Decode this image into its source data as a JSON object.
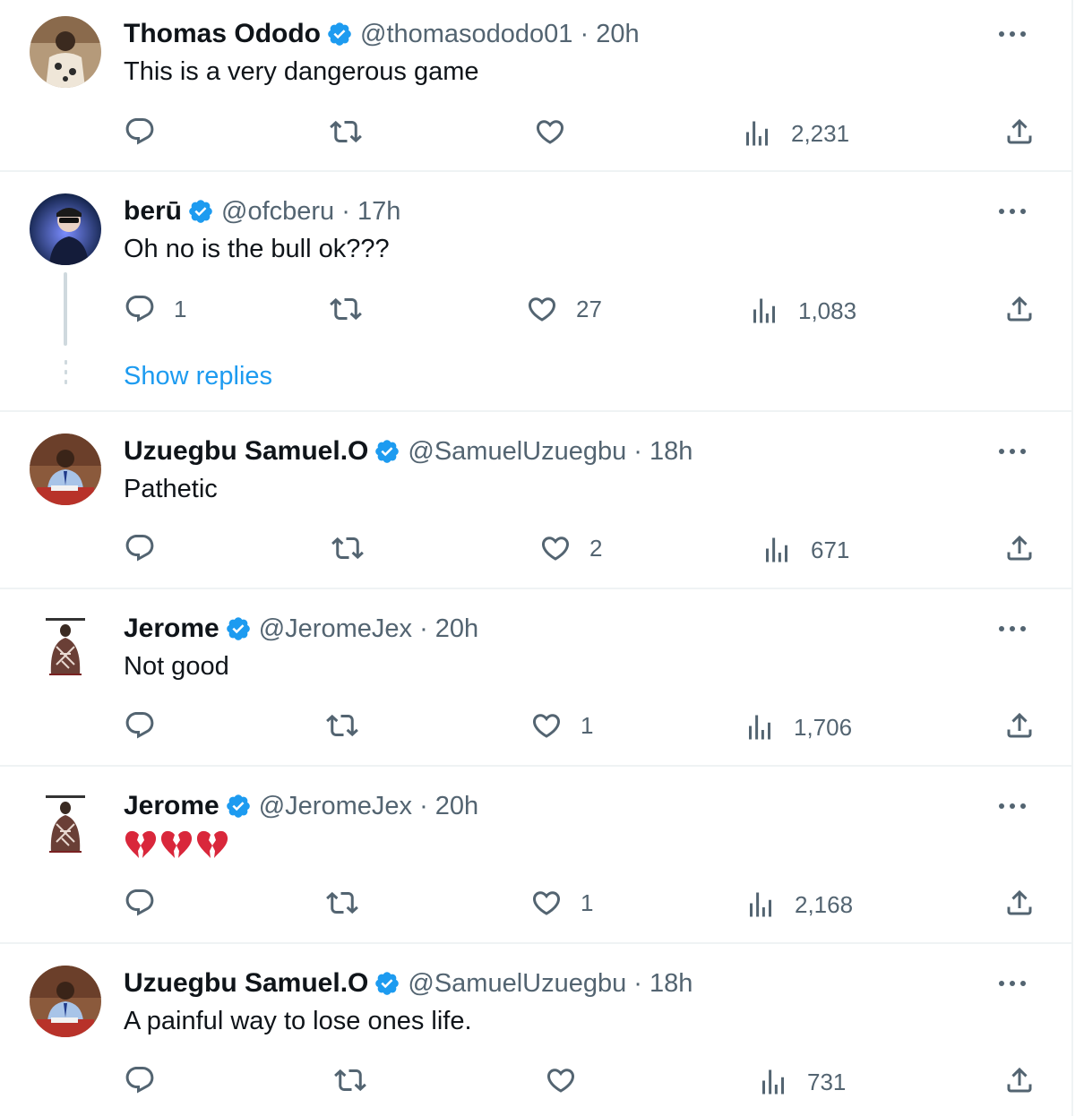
{
  "colors": {
    "accent": "#1d9bf0",
    "text": "#0f1419",
    "secondary": "#536471",
    "divider": "#eff3f4",
    "heart": "#d9273b"
  },
  "icons": {
    "reply": "speech-bubble-icon",
    "retweet": "retweet-arrows-icon",
    "like": "heart-icon",
    "views": "bar-chart-icon",
    "share": "upload-icon",
    "verified": "blue-check-badge-icon",
    "more": "three-dots-icon"
  },
  "tweets": [
    {
      "name": "Thomas Ododo",
      "handle": "@thomasododo01",
      "time": "20h",
      "text": "This is a very dangerous game",
      "replies": "",
      "likes": "",
      "views": "2,231"
    },
    {
      "name": "berū",
      "handle": "@ofcberu",
      "time": "17h",
      "text": "Oh no is the bull ok???",
      "replies": "1",
      "likes": "27",
      "views": "1,083",
      "show_replies": "Show replies"
    },
    {
      "name": "Uzuegbu Samuel.O",
      "handle": "@SamuelUzuegbu",
      "time": "18h",
      "text": "Pathetic",
      "replies": "",
      "likes": "2",
      "views": "671"
    },
    {
      "name": "Jerome",
      "handle": "@JeromeJex",
      "time": "20h",
      "text": "Not good",
      "replies": "",
      "likes": "1",
      "views": "1,706"
    },
    {
      "name": "Jerome",
      "handle": "@JeromeJex",
      "time": "20h",
      "text": "",
      "emoji": [
        "broken-heart",
        "broken-heart",
        "broken-heart"
      ],
      "replies": "",
      "likes": "1",
      "views": "2,168"
    },
    {
      "name": "Uzuegbu Samuel.O",
      "handle": "@SamuelUzuegbu",
      "time": "18h",
      "text": "A painful way to lose ones life.",
      "replies": "",
      "likes": "",
      "views": "731"
    }
  ]
}
